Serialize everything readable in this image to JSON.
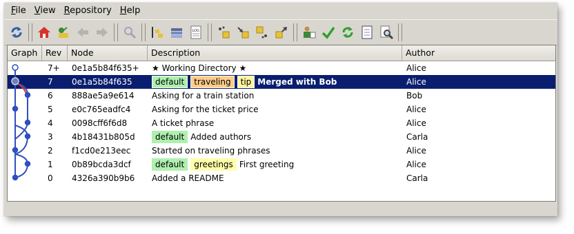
{
  "menu": [
    {
      "label": "File",
      "underline": "F",
      "rest": "ile"
    },
    {
      "label": "View",
      "underline": "V",
      "rest": "iew"
    },
    {
      "label": "Repository",
      "underline": "R",
      "rest": "epository"
    },
    {
      "label": "Help",
      "underline": "H",
      "rest": "elp"
    }
  ],
  "toolbar": [
    {
      "name": "refresh-icon",
      "enabled": true
    },
    {
      "sep": true
    },
    {
      "name": "home-icon",
      "enabled": true
    },
    {
      "name": "goto-revision-icon",
      "enabled": true
    },
    {
      "name": "back-arrow-icon",
      "enabled": false
    },
    {
      "name": "forward-arrow-icon",
      "enabled": false
    },
    {
      "sep": true
    },
    {
      "name": "find-icon",
      "enabled": false
    },
    {
      "sep": true
    },
    {
      "name": "branch-filter-icon",
      "enabled": true
    },
    {
      "name": "layers-icon",
      "enabled": true
    },
    {
      "name": "log-file-icon",
      "enabled": true
    },
    {
      "sep": true
    },
    {
      "name": "incoming-icon",
      "enabled": true
    },
    {
      "name": "pull-icon",
      "enabled": true
    },
    {
      "name": "outgoing-icon",
      "enabled": true
    },
    {
      "name": "push-icon",
      "enabled": true
    },
    {
      "sep": true
    },
    {
      "name": "user-icon",
      "enabled": true
    },
    {
      "name": "accept-check-icon",
      "enabled": true
    },
    {
      "name": "sync-icon",
      "enabled": true
    },
    {
      "name": "document-icon",
      "enabled": true
    },
    {
      "name": "inspect-icon",
      "enabled": true
    },
    {
      "sep": true
    }
  ],
  "columns": [
    "Graph",
    "Rev",
    "Node",
    "Description",
    "Author"
  ],
  "rows": [
    {
      "rev": "7+",
      "node": "0e1a5b84f635+",
      "tags": [],
      "desc": "★ Working Directory ★",
      "bold": false,
      "author": "Alice",
      "selected": false
    },
    {
      "rev": "7",
      "node": "0e1a5b84f635",
      "tags": [
        {
          "text": "default",
          "kind": "default"
        },
        {
          "text": "traveling",
          "kind": "traveling"
        },
        {
          "text": "tip",
          "kind": "tip"
        }
      ],
      "desc": "Merged with Bob",
      "bold": true,
      "author": "Alice",
      "selected": true
    },
    {
      "rev": "6",
      "node": "888ae5a9e614",
      "tags": [],
      "desc": "Asking for a train station",
      "bold": false,
      "author": "Bob",
      "selected": false
    },
    {
      "rev": "5",
      "node": "e0c765eadfc4",
      "tags": [],
      "desc": "Asking for the ticket price",
      "bold": false,
      "author": "Alice",
      "selected": false
    },
    {
      "rev": "4",
      "node": "0098cff6f6d8",
      "tags": [],
      "desc": "A ticket phrase",
      "bold": false,
      "author": "Alice",
      "selected": false
    },
    {
      "rev": "3",
      "node": "4b18431b805d",
      "tags": [
        {
          "text": "default",
          "kind": "default"
        }
      ],
      "desc": "Added authors",
      "bold": false,
      "author": "Carla",
      "selected": false
    },
    {
      "rev": "2",
      "node": "f1cd0e213eec",
      "tags": [],
      "desc": "Started on traveling phrases",
      "bold": false,
      "author": "Alice",
      "selected": false
    },
    {
      "rev": "1",
      "node": "0b89bcda3dcf",
      "tags": [
        {
          "text": "default",
          "kind": "default"
        },
        {
          "text": "greetings",
          "kind": "greetings"
        }
      ],
      "desc": "First greeting",
      "bold": false,
      "author": "Alice",
      "selected": false
    },
    {
      "rev": "0",
      "node": "4326a390b9b6",
      "tags": [],
      "desc": "Added a README",
      "bold": false,
      "author": "Carla",
      "selected": false
    }
  ],
  "colors": {
    "selection": "#0a1e6f",
    "graph": "#2f4fbf",
    "merge_link": "#e03030"
  }
}
